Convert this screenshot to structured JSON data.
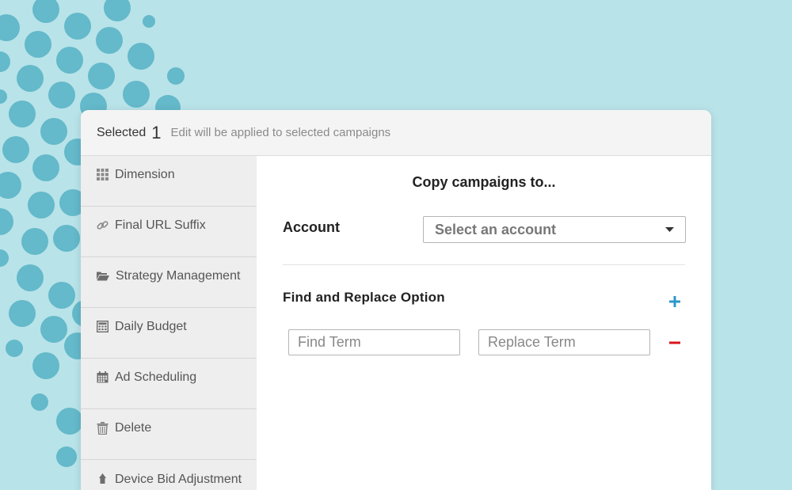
{
  "colors": {
    "background": "#b8e3e9",
    "dot": "#55b1c4",
    "add_icon": "#2d97c9",
    "remove_icon": "#d9141a"
  },
  "header": {
    "selected_label": "Selected",
    "selected_count": "1",
    "note": "Edit will be applied to selected campaigns"
  },
  "sidebar": {
    "items": [
      {
        "label": "Dimension",
        "icon": "grid-icon"
      },
      {
        "label": "Final URL Suffix",
        "icon": "link-icon"
      },
      {
        "label": "Strategy Management",
        "icon": "folder-open-icon"
      },
      {
        "label": "Daily Budget",
        "icon": "calculator-icon"
      },
      {
        "label": "Ad Scheduling",
        "icon": "calendar-icon"
      },
      {
        "label": "Delete",
        "icon": "trash-icon"
      },
      {
        "label": "Device Bid Adjustment",
        "icon": "device-icon"
      }
    ]
  },
  "main": {
    "title": "Copy campaigns to...",
    "account_label": "Account",
    "account_select_placeholder": "Select an account",
    "find_replace_label": "Find and Replace Option",
    "find_placeholder": "Find Term",
    "replace_placeholder": "Replace Term"
  }
}
